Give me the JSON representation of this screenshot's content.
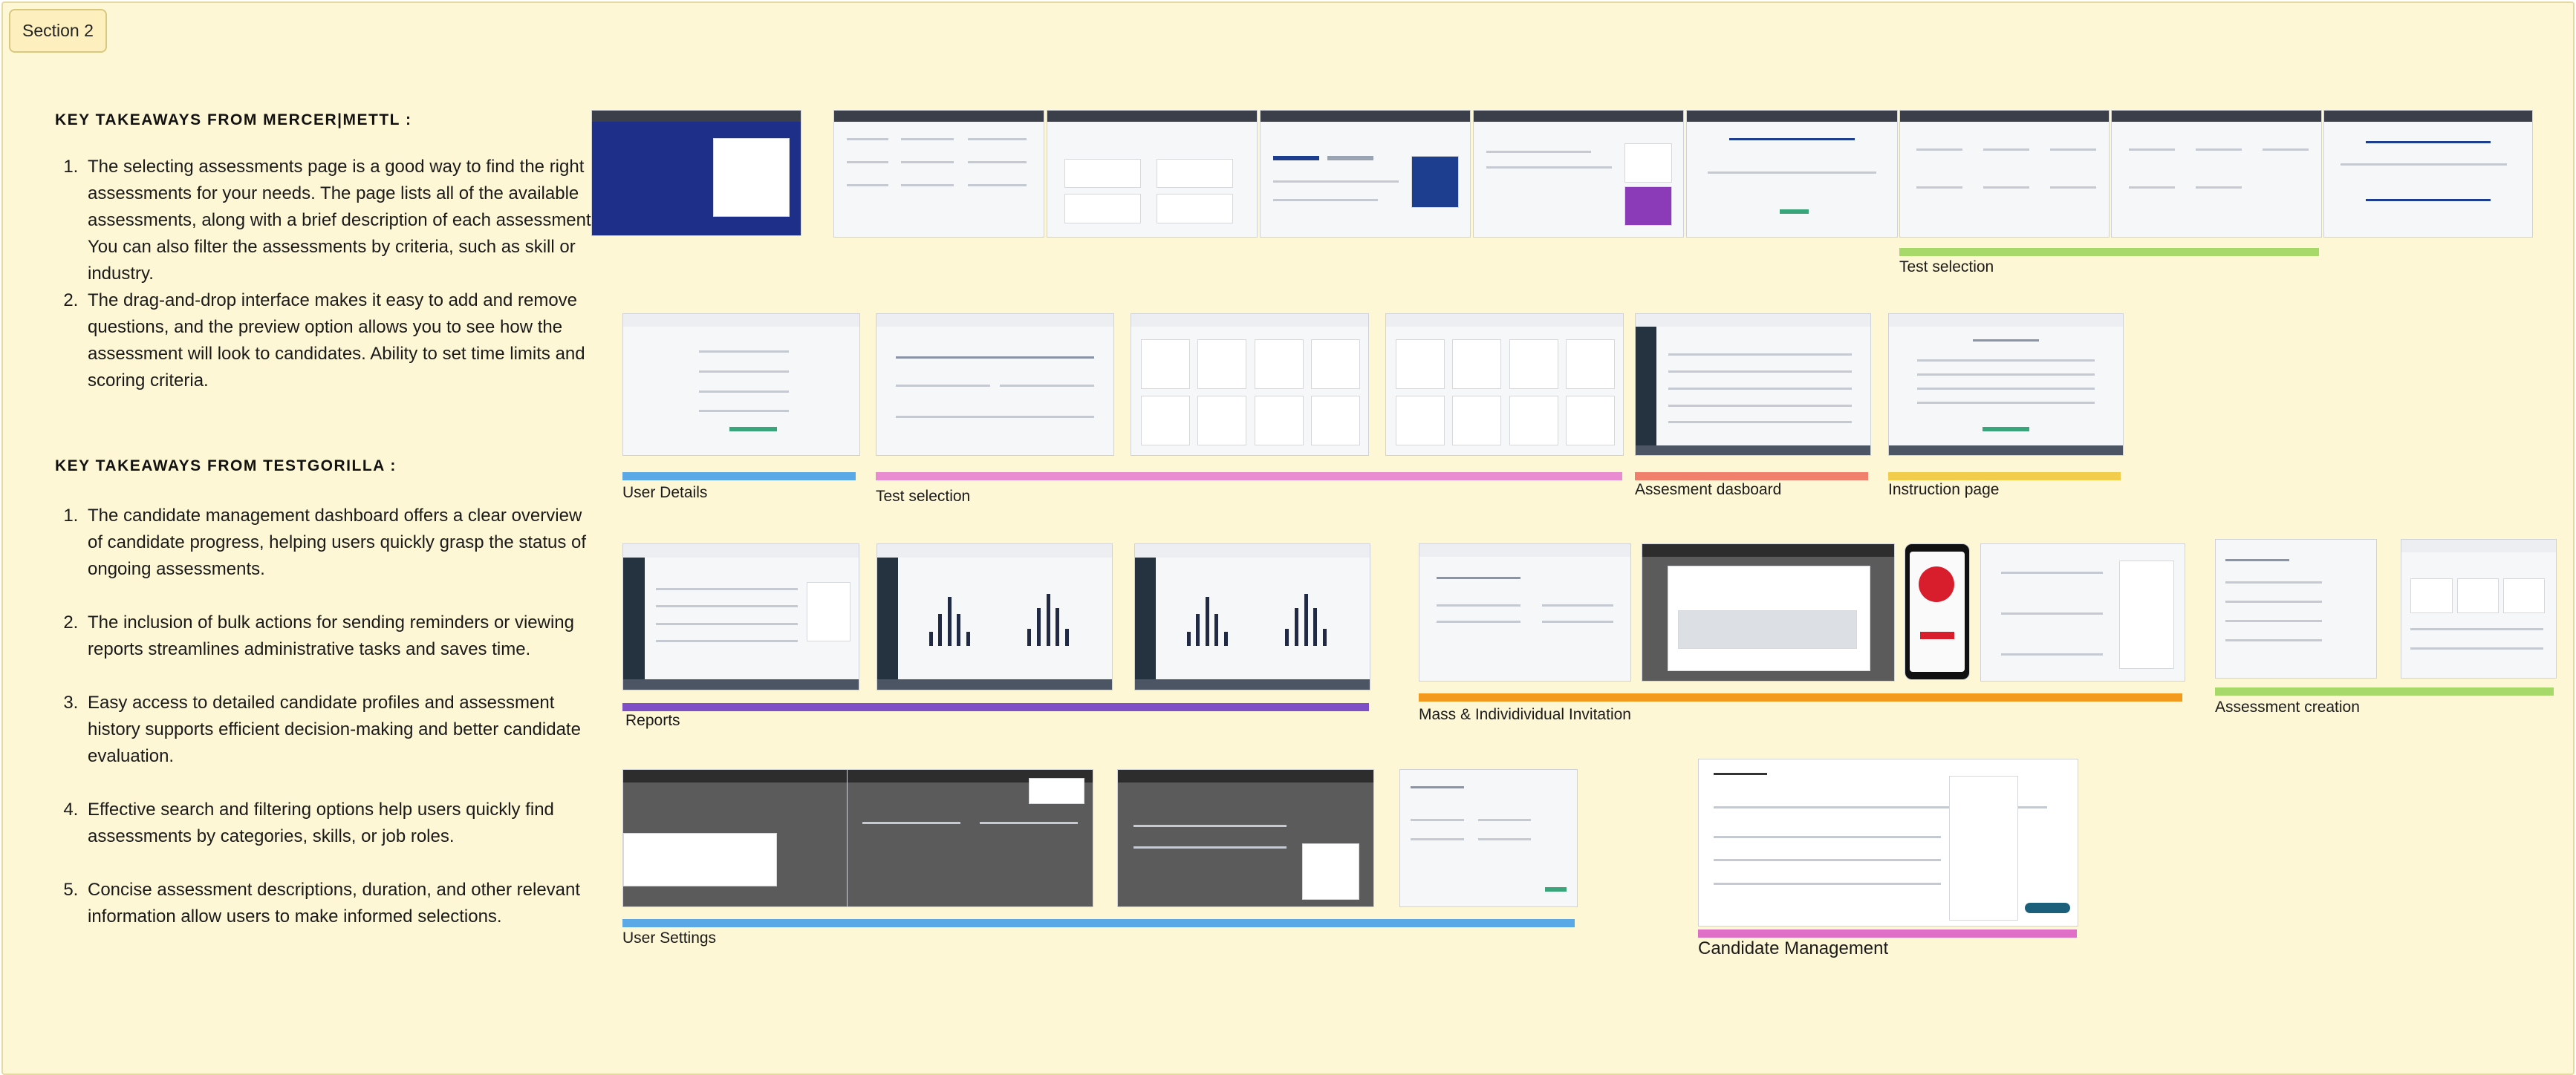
{
  "section_label": "Section 2",
  "mercer": {
    "heading": "KEY TAKEAWAYS FROM MERCER|METTL :",
    "points": [
      "The selecting assessments page is a good way to find the right assessments for your needs. The page lists all of the available assessments, along with a brief description of each assessment. You can also filter the assessments by criteria, such as skill or industry.",
      "The drag-and-drop interface makes it easy to add and remove questions, and the preview option allows you to see how the assessment will look to candidates. Ability to set time limits and scoring criteria."
    ]
  },
  "testgorilla": {
    "heading": "KEY TAKEAWAYS FROM TESTGORILLA :",
    "points": [
      "The candidate management dashboard offers a clear overview of candidate progress, helping users quickly grasp the status of ongoing assessments.",
      " The inclusion of bulk actions for sending reminders or viewing reports streamlines administrative tasks and saves time.",
      "Easy access to detailed candidate profiles and assessment history supports efficient decision-making and better candidate evaluation.",
      "Effective search and filtering options help users quickly find assessments by categories, skills, or job roles.",
      "Concise assessment descriptions, duration, and other relevant information allow users to make informed selections."
    ]
  },
  "captions": {
    "mercer_test_selection": "Test selection",
    "user_details": "User Details",
    "tg_test_selection": "Test selection",
    "assessment_dashboard": "Assesment dasboard",
    "instruction_page": "Instruction page",
    "reports": "Reports",
    "mass_invitation": "Mass & Individividual Invitation",
    "assessment_creation": "Assessment creation",
    "user_settings": "User Settings",
    "candidate_management": "Candidate Management"
  },
  "colors": {
    "board": "#fef7d6",
    "green": "#a6d96a",
    "blue": "#5aa9e6",
    "pink": "#e98bd0",
    "salmon": "#f07f6b",
    "yellow": "#f2cc4b",
    "purple": "#7e4fc7",
    "orange": "#f39a1e",
    "magenta": "#e06fc8"
  }
}
